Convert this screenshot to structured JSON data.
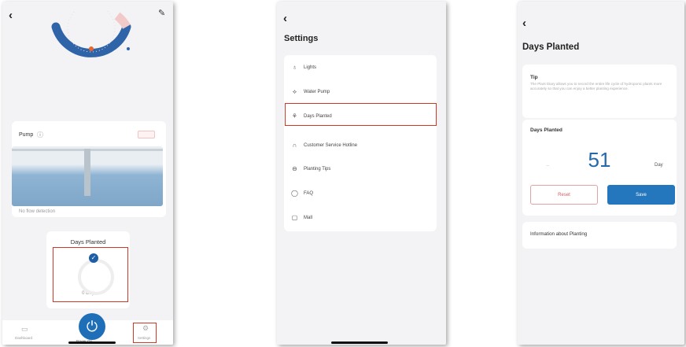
{
  "screen1": {
    "pump": {
      "title": "Pump",
      "status_hint": "No flow detection"
    },
    "days_card": {
      "title": "Days Planted",
      "caption": "0 Day"
    },
    "nav": {
      "left_label": "Dashboard",
      "center_label": "Power On",
      "right_label": "Settings"
    }
  },
  "screen2": {
    "title": "Settings",
    "items": [
      {
        "icon": "light-icon",
        "label": "Lights"
      },
      {
        "icon": "water-pump-icon",
        "label": "Water Pump"
      },
      {
        "icon": "plant-icon",
        "label": "Days Planted"
      },
      {
        "icon": "headset-icon",
        "label": "Customer Service Hotline"
      },
      {
        "icon": "tips-icon",
        "label": "Planting Tips"
      },
      {
        "icon": "faq-icon",
        "label": "FAQ"
      },
      {
        "icon": "mall-icon",
        "label": "Mall"
      }
    ]
  },
  "screen3": {
    "title": "Days Planted",
    "tip_title": "Tip",
    "tip_text": "The Plant Diary allows you to record the entire life cycle of hydroponic plants more accurately so that you can enjoy a better planting experience.",
    "days_label": "Days Planted",
    "days_value": "51",
    "unit": "Day",
    "reset_label": "Reset",
    "save_label": "Save",
    "info_label": "Information about Planting"
  },
  "colors": {
    "accent": "#2577bd",
    "gauge_blue": "#2f64a8",
    "highlight_red": "#d03a24"
  }
}
